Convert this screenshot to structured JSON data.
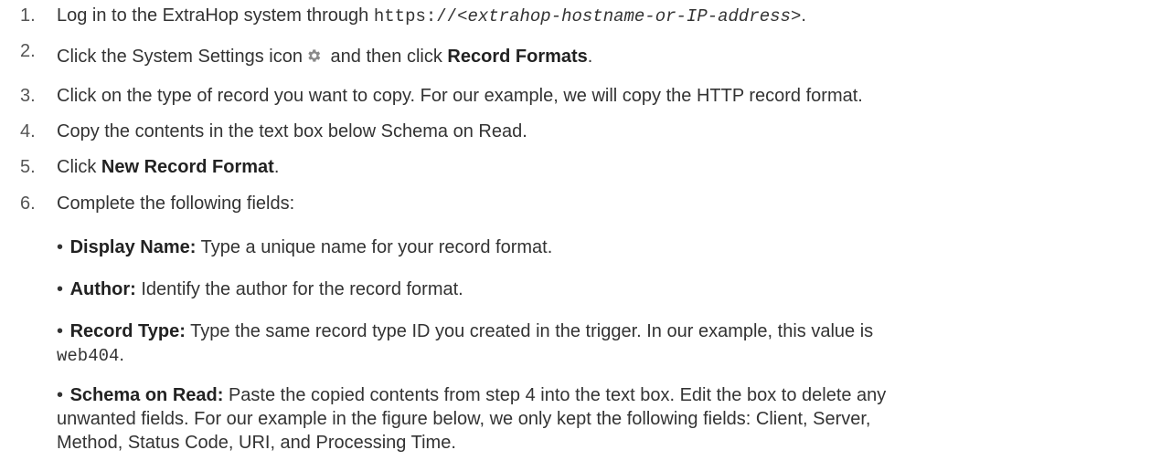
{
  "steps": [
    {
      "num": "1.",
      "pre": "Log in to the ExtraHop system through ",
      "mono": "https://",
      "mono_it": "<extrahop-hostname-or-IP-address>",
      "post": "."
    },
    {
      "num": "2.",
      "pre": "Click the System Settings icon",
      "mid": " and then click ",
      "bold": "Record Formats",
      "post": "."
    },
    {
      "num": "3.",
      "text": "Click on the type of record you want to copy. For our example, we will copy the HTTP record format."
    },
    {
      "num": "4.",
      "text": "Copy the contents in the text box below Schema on Read."
    },
    {
      "num": "5.",
      "pre": "Click ",
      "bold": "New Record Format",
      "post": "."
    },
    {
      "num": "6.",
      "text": "Complete the following fields:"
    }
  ],
  "fields": [
    {
      "bullet": "•",
      "label": "Display Name:",
      "text": " Type a unique name for your record format."
    },
    {
      "bullet": "•",
      "label": "Author:",
      "text": " Identify the author for the record format."
    },
    {
      "bullet": "•",
      "label": "Record Type:",
      "text": " Type the same record type ID you created in the trigger. In our example, this value is",
      "code": "web404",
      "post": "."
    },
    {
      "bullet": "•",
      "label": "Schema on Read:",
      "text": " Paste the copied contents from step 4 into the text box. Edit the box to delete any",
      "line2": "unwanted fields. For our example in the figure below, we only kept the following fields: Client, Server,",
      "line3": "Method, Status Code, URI, and Processing Time."
    }
  ],
  "icons": {
    "settings": "gear-icon"
  },
  "colors": {
    "text": "#333333",
    "icon": "#8a8a8a"
  }
}
